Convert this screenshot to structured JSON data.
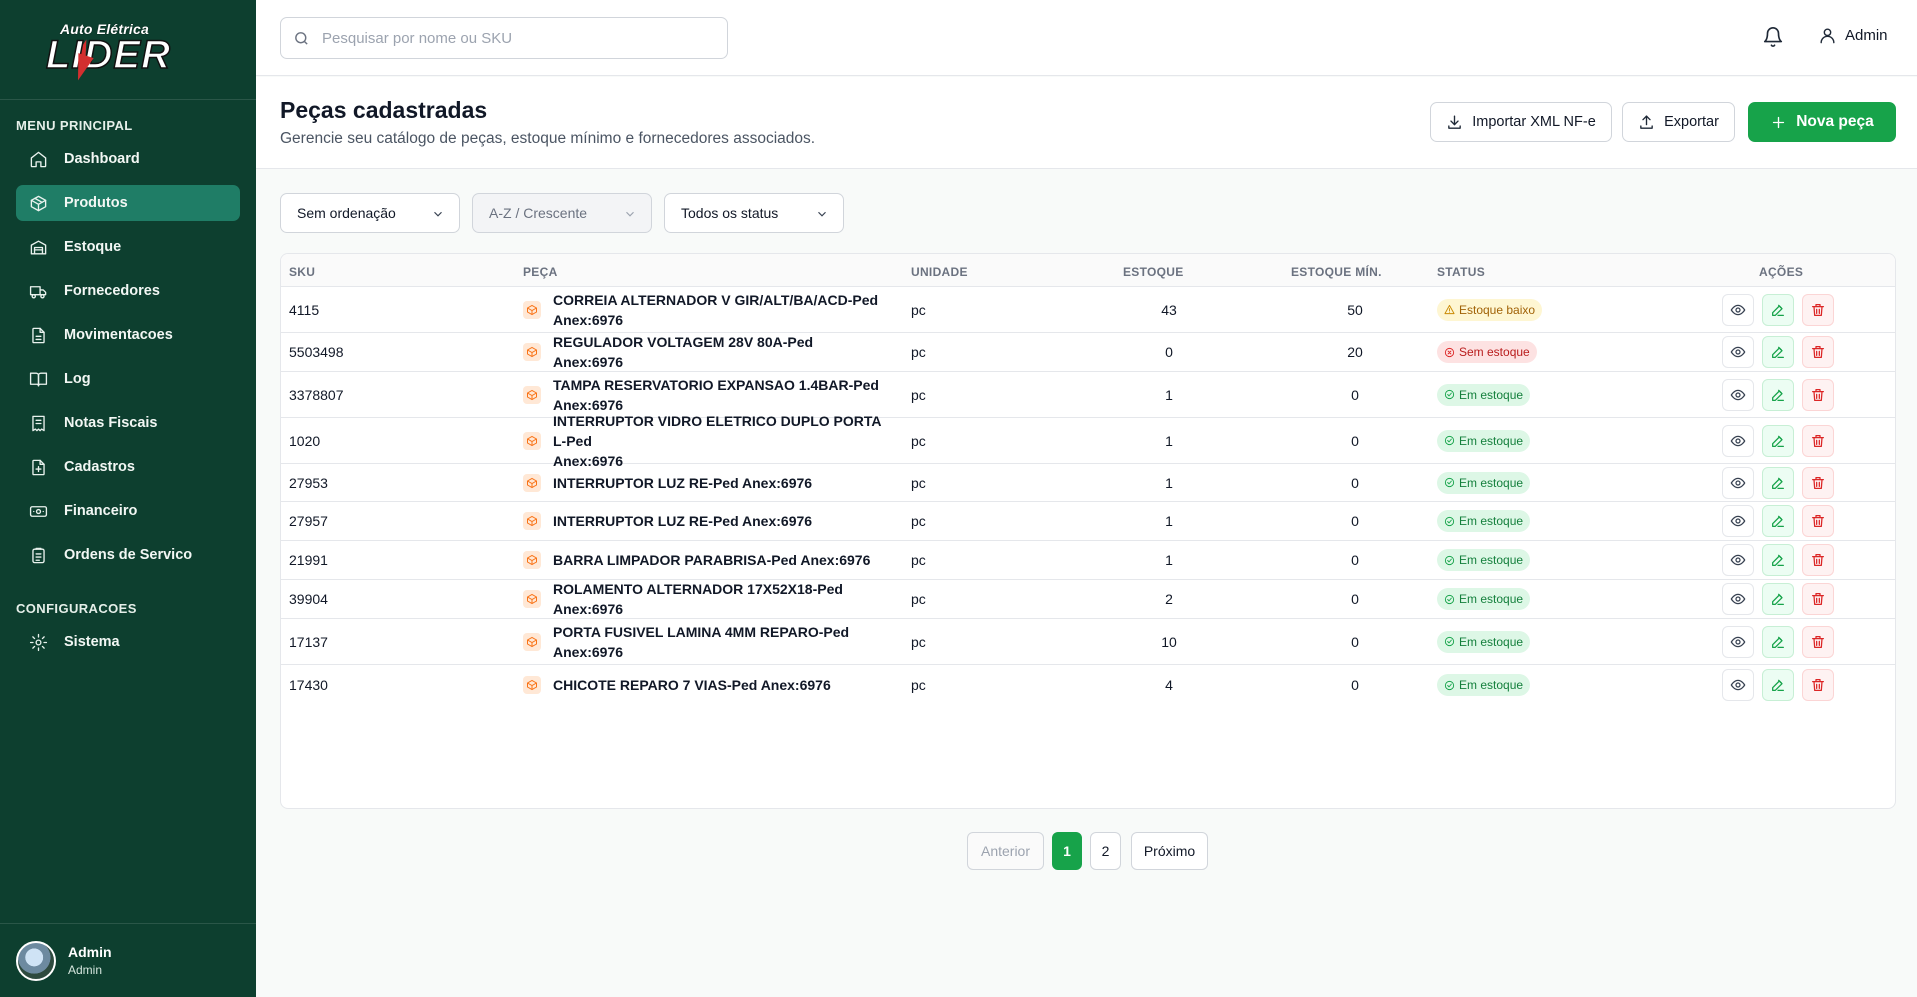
{
  "brand": {
    "logo_top": "Auto Elétrica",
    "logo_main": "LIDER"
  },
  "sidebar": {
    "main_title": "MENU PRINCIPAL",
    "items": [
      {
        "label": "Dashboard",
        "icon": "home-icon",
        "active": false
      },
      {
        "label": "Produtos",
        "icon": "package-icon",
        "active": true
      },
      {
        "label": "Estoque",
        "icon": "warehouse-icon",
        "active": false
      },
      {
        "label": "Fornecedores",
        "icon": "truck-icon",
        "active": false
      },
      {
        "label": "Movimentacoes",
        "icon": "file-text-icon",
        "active": false
      },
      {
        "label": "Log",
        "icon": "book-open-icon",
        "active": false
      },
      {
        "label": "Notas Fiscais",
        "icon": "receipt-icon",
        "active": false
      },
      {
        "label": "Cadastros",
        "icon": "file-plus-icon",
        "active": false
      },
      {
        "label": "Financeiro",
        "icon": "banknote-icon",
        "active": false
      },
      {
        "label": "Ordens de Servico",
        "icon": "clipboard-icon",
        "active": false
      }
    ],
    "config_title": "CONFIGURACOES",
    "config_items": [
      {
        "label": "Sistema",
        "icon": "gear-icon"
      }
    ],
    "user": {
      "name": "Admin",
      "role": "Admin"
    }
  },
  "topbar": {
    "search_placeholder": "Pesquisar por nome ou SKU",
    "search_value": "",
    "user_label": "Admin"
  },
  "header": {
    "title": "Peças cadastradas",
    "subtitle": "Gerencie seu catálogo de peças, estoque mínimo e fornecedores associados.",
    "import_label": "Importar XML NF-e",
    "export_label": "Exportar",
    "new_label": "Nova peça"
  },
  "filters": {
    "sort": "Sem ordenação",
    "direction": "A-Z / Crescente",
    "status": "Todos os status"
  },
  "table": {
    "columns": [
      "SKU",
      "PEÇA",
      "UNIDADE",
      "ESTOQUE",
      "ESTOQUE MÍN.",
      "STATUS",
      "AÇÕES"
    ],
    "rows": [
      {
        "sku": "4115",
        "name_l1": "CORREIA ALTERNADOR V GIR/ALT/BA/ACD-Ped",
        "name_l2": "Anex:6976",
        "unit": "pc",
        "stock": "43",
        "min": "50",
        "status": "Estoque baixo",
        "status_type": "low"
      },
      {
        "sku": "5503498",
        "name_l1": "REGULADOR VOLTAGEM 28V 80A-Ped Anex:6976",
        "name_l2": "",
        "unit": "pc",
        "stock": "0",
        "min": "20",
        "status": "Sem estoque",
        "status_type": "out"
      },
      {
        "sku": "3378807",
        "name_l1": "TAMPA RESERVATORIO EXPANSAO 1.4BAR-Ped",
        "name_l2": "Anex:6976",
        "unit": "pc",
        "stock": "1",
        "min": "0",
        "status": "Em estoque",
        "status_type": "ok"
      },
      {
        "sku": "1020",
        "name_l1": "INTERRUPTOR VIDRO ELETRICO DUPLO PORTA L-Ped",
        "name_l2": "Anex:6976",
        "unit": "pc",
        "stock": "1",
        "min": "0",
        "status": "Em estoque",
        "status_type": "ok"
      },
      {
        "sku": "27953",
        "name_l1": "INTERRUPTOR LUZ RE-Ped Anex:6976",
        "name_l2": "",
        "unit": "pc",
        "stock": "1",
        "min": "0",
        "status": "Em estoque",
        "status_type": "ok"
      },
      {
        "sku": "27957",
        "name_l1": "INTERRUPTOR LUZ RE-Ped Anex:6976",
        "name_l2": "",
        "unit": "pc",
        "stock": "1",
        "min": "0",
        "status": "Em estoque",
        "status_type": "ok"
      },
      {
        "sku": "21991",
        "name_l1": "BARRA LIMPADOR PARABRISA-Ped Anex:6976",
        "name_l2": "",
        "unit": "pc",
        "stock": "1",
        "min": "0",
        "status": "Em estoque",
        "status_type": "ok"
      },
      {
        "sku": "39904",
        "name_l1": "ROLAMENTO ALTERNADOR 17X52X18-Ped Anex:6976",
        "name_l2": "",
        "unit": "pc",
        "stock": "2",
        "min": "0",
        "status": "Em estoque",
        "status_type": "ok"
      },
      {
        "sku": "17137",
        "name_l1": "PORTA FUSIVEL LAMINA 4MM REPARO-Ped",
        "name_l2": "Anex:6976",
        "unit": "pc",
        "stock": "10",
        "min": "0",
        "status": "Em estoque",
        "status_type": "ok"
      },
      {
        "sku": "17430",
        "name_l1": "CHICOTE REPARO 7 VIAS-Ped Anex:6976",
        "name_l2": "",
        "unit": "pc",
        "stock": "4",
        "min": "0",
        "status": "Em estoque",
        "status_type": "ok"
      }
    ]
  },
  "pagination": {
    "prev": "Anterior",
    "pages": [
      "1",
      "2"
    ],
    "current": "1",
    "next": "Próximo"
  },
  "colors": {
    "sidebar_bg": "#0d3f2f",
    "active_nav": "#1f7d66",
    "primary": "#17a34a",
    "danger": "#dc2626",
    "warning": "#ca8a04"
  }
}
